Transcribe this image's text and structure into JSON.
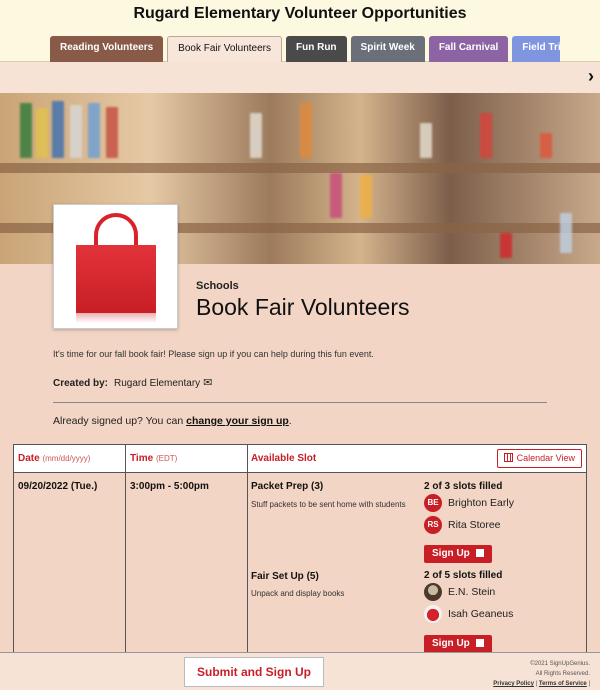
{
  "header": {
    "site_title": "Rugard Elementary Volunteer Opportunities",
    "tabs": [
      {
        "label": "Reading Volunteers",
        "color": "#8a5a48"
      },
      {
        "label": "Book Fair Volunteers",
        "color": "#f8e6da",
        "active": true
      },
      {
        "label": "Fun Run",
        "color": "#4a4a4a"
      },
      {
        "label": "Spirit Week",
        "color": "#6b6f7a"
      },
      {
        "label": "Fall Carnival",
        "color": "#8c63a3"
      },
      {
        "label": "Field Trip Chaperones",
        "color": "#7f95e0"
      }
    ],
    "next_icon": "chevron-right-icon"
  },
  "event": {
    "category": "Schools",
    "title": "Book Fair Volunteers",
    "description": "It's time for our fall book fair!  Please sign up if you can help during this fun event.",
    "created_by_label": "Created by:",
    "created_by_name": "Rugard Elementary",
    "already_text": "Already signed up? You can ",
    "change_link": "change your sign up",
    "already_suffix": "."
  },
  "table": {
    "date_header": "Date",
    "date_format": "(mm/dd/yyyy)",
    "time_header": "Time",
    "time_zone": "(EDT)",
    "slot_header": "Available Slot",
    "calendar_button": "Calendar View",
    "rows": [
      {
        "date": "09/20/2022 (Tue.)",
        "time": "3:00pm - 5:00pm",
        "slots": [
          {
            "name": "Packet Prep (3)",
            "description": "Stuff packets to be sent home with students",
            "filled": "2 of 3 slots filled",
            "volunteers": [
              {
                "initials": "BE",
                "name": "Brighton Early",
                "avatar": "initials"
              },
              {
                "initials": "RS",
                "name": "Rita Storee",
                "avatar": "initials"
              }
            ],
            "button": "Sign Up"
          },
          {
            "name": "Fair Set Up (5)",
            "description": "Unpack and display books",
            "filled": "2 of 5 slots filled",
            "volunteers": [
              {
                "initials": "",
                "name": "E.N. Stein",
                "avatar": "photo"
              },
              {
                "initials": "",
                "name": "Isah Geaneus",
                "avatar": "apple"
              }
            ],
            "button": "Sign Up"
          }
        ]
      }
    ]
  },
  "footer": {
    "submit": "Submit and Sign Up",
    "copyright": "©2021 SignUpGenius.",
    "rights": "All Rights Reserved.",
    "privacy": "Privacy Policy",
    "separator": "|",
    "terms": "Terms of Service",
    "trailing_separator": "|"
  }
}
